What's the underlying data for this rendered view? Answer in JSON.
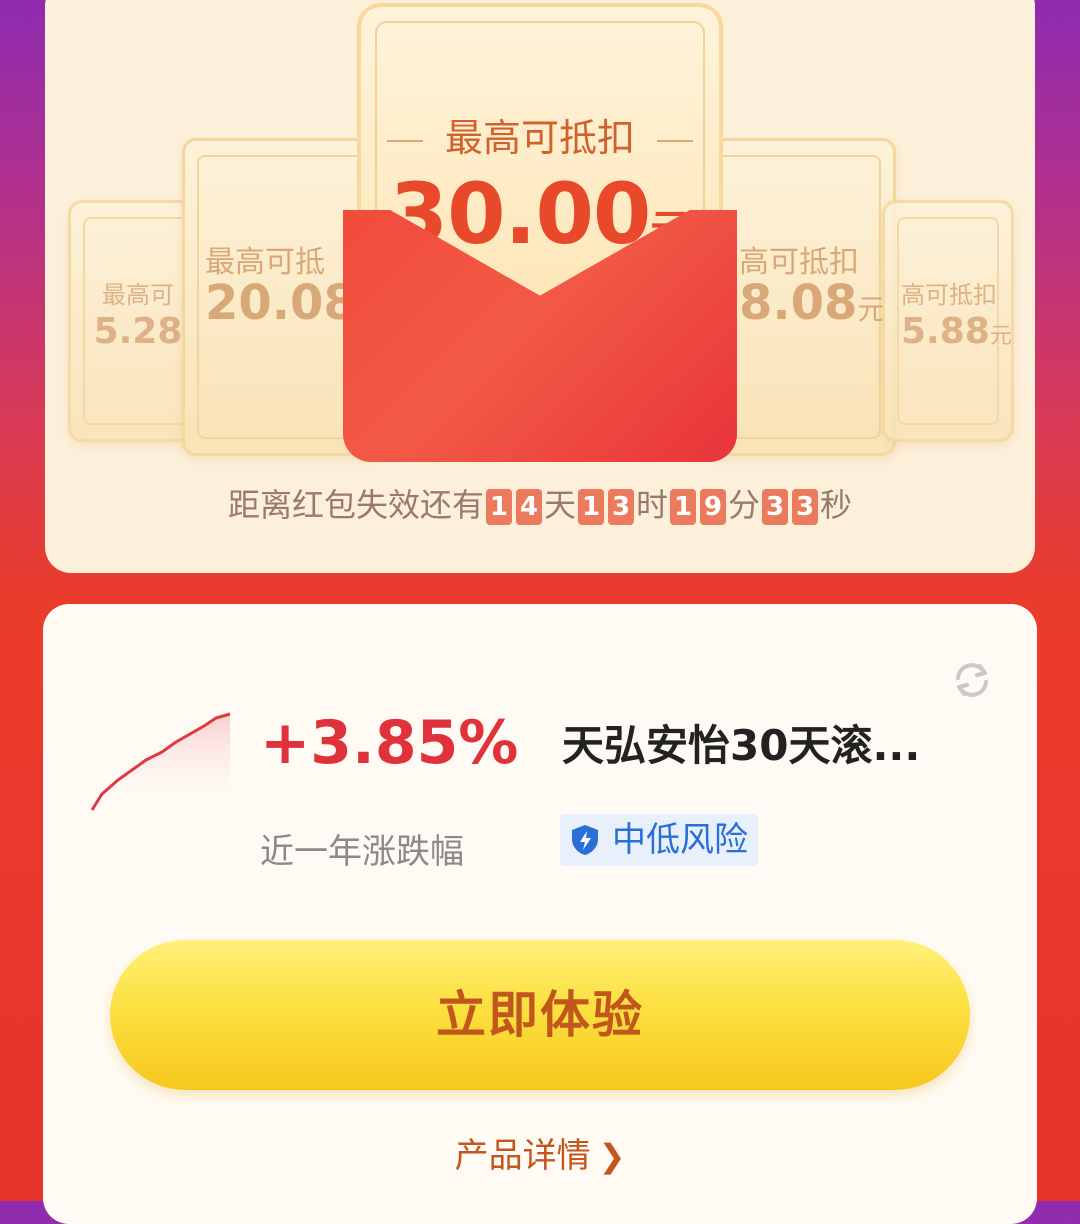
{
  "coupons": {
    "center": {
      "label": "最高可抵扣",
      "amount": "30.00",
      "unit": "元"
    },
    "left_far": {
      "label": "最高可",
      "amount": "5.28"
    },
    "left_near": {
      "label": "最高可抵",
      "amount": "20.08"
    },
    "right_near": {
      "label": "高可抵扣",
      "amount": "8.08",
      "unit": "元"
    },
    "right_far": {
      "label": "高可抵扣",
      "amount": "5.88",
      "unit": "元"
    }
  },
  "countdown": {
    "prefix": "距离红包失效还有",
    "days": [
      "1",
      "4"
    ],
    "day_unit": "天",
    "hours": [
      "1",
      "3"
    ],
    "hour_unit": "时",
    "minutes": [
      "1",
      "9"
    ],
    "minute_unit": "分",
    "seconds": [
      "3",
      "3"
    ],
    "second_unit": "秒"
  },
  "fund": {
    "return_pct": "+3.85%",
    "return_label": "近一年涨跌幅",
    "name": "天弘安怡30天滚...",
    "risk_label": "中低风险"
  },
  "cta": {
    "label": "立即体验"
  },
  "details": {
    "label": "产品详情"
  },
  "colors": {
    "accent_red": "#e0323a",
    "cta_text": "#c2571e",
    "risk_blue": "#2a6fd6"
  }
}
